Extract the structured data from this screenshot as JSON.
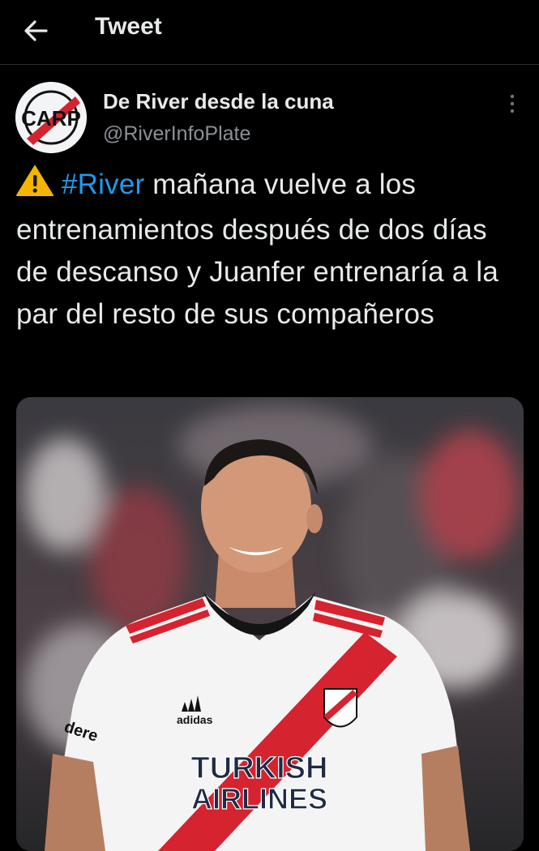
{
  "header": {
    "title": "Tweet"
  },
  "author": {
    "name": "De River desde la cuna",
    "handle": "@RiverInfoPlate",
    "avatar_letters": "CARP"
  },
  "tweet": {
    "hashtag": "#River",
    "text": "mañana vuelve a los entrenamientos después de dos días de descanso y Juanfer entrenaría a la par del resto de sus compañeros"
  },
  "media": {
    "jersey_brand": "adidas",
    "sponsor_line1": "TURKISH",
    "sponsor_line2": "AIRLINES",
    "sleeve_text": "dere"
  },
  "colors": {
    "background": "#000000",
    "text": "#e7e9ea",
    "secondary": "#8b9096",
    "link": "#1d9bf0",
    "warning": "#f4b400",
    "club_red": "#d5232f"
  },
  "icons": {
    "back": "arrow-left-icon",
    "more": "more-vertical-icon",
    "warning": "warning-icon"
  }
}
